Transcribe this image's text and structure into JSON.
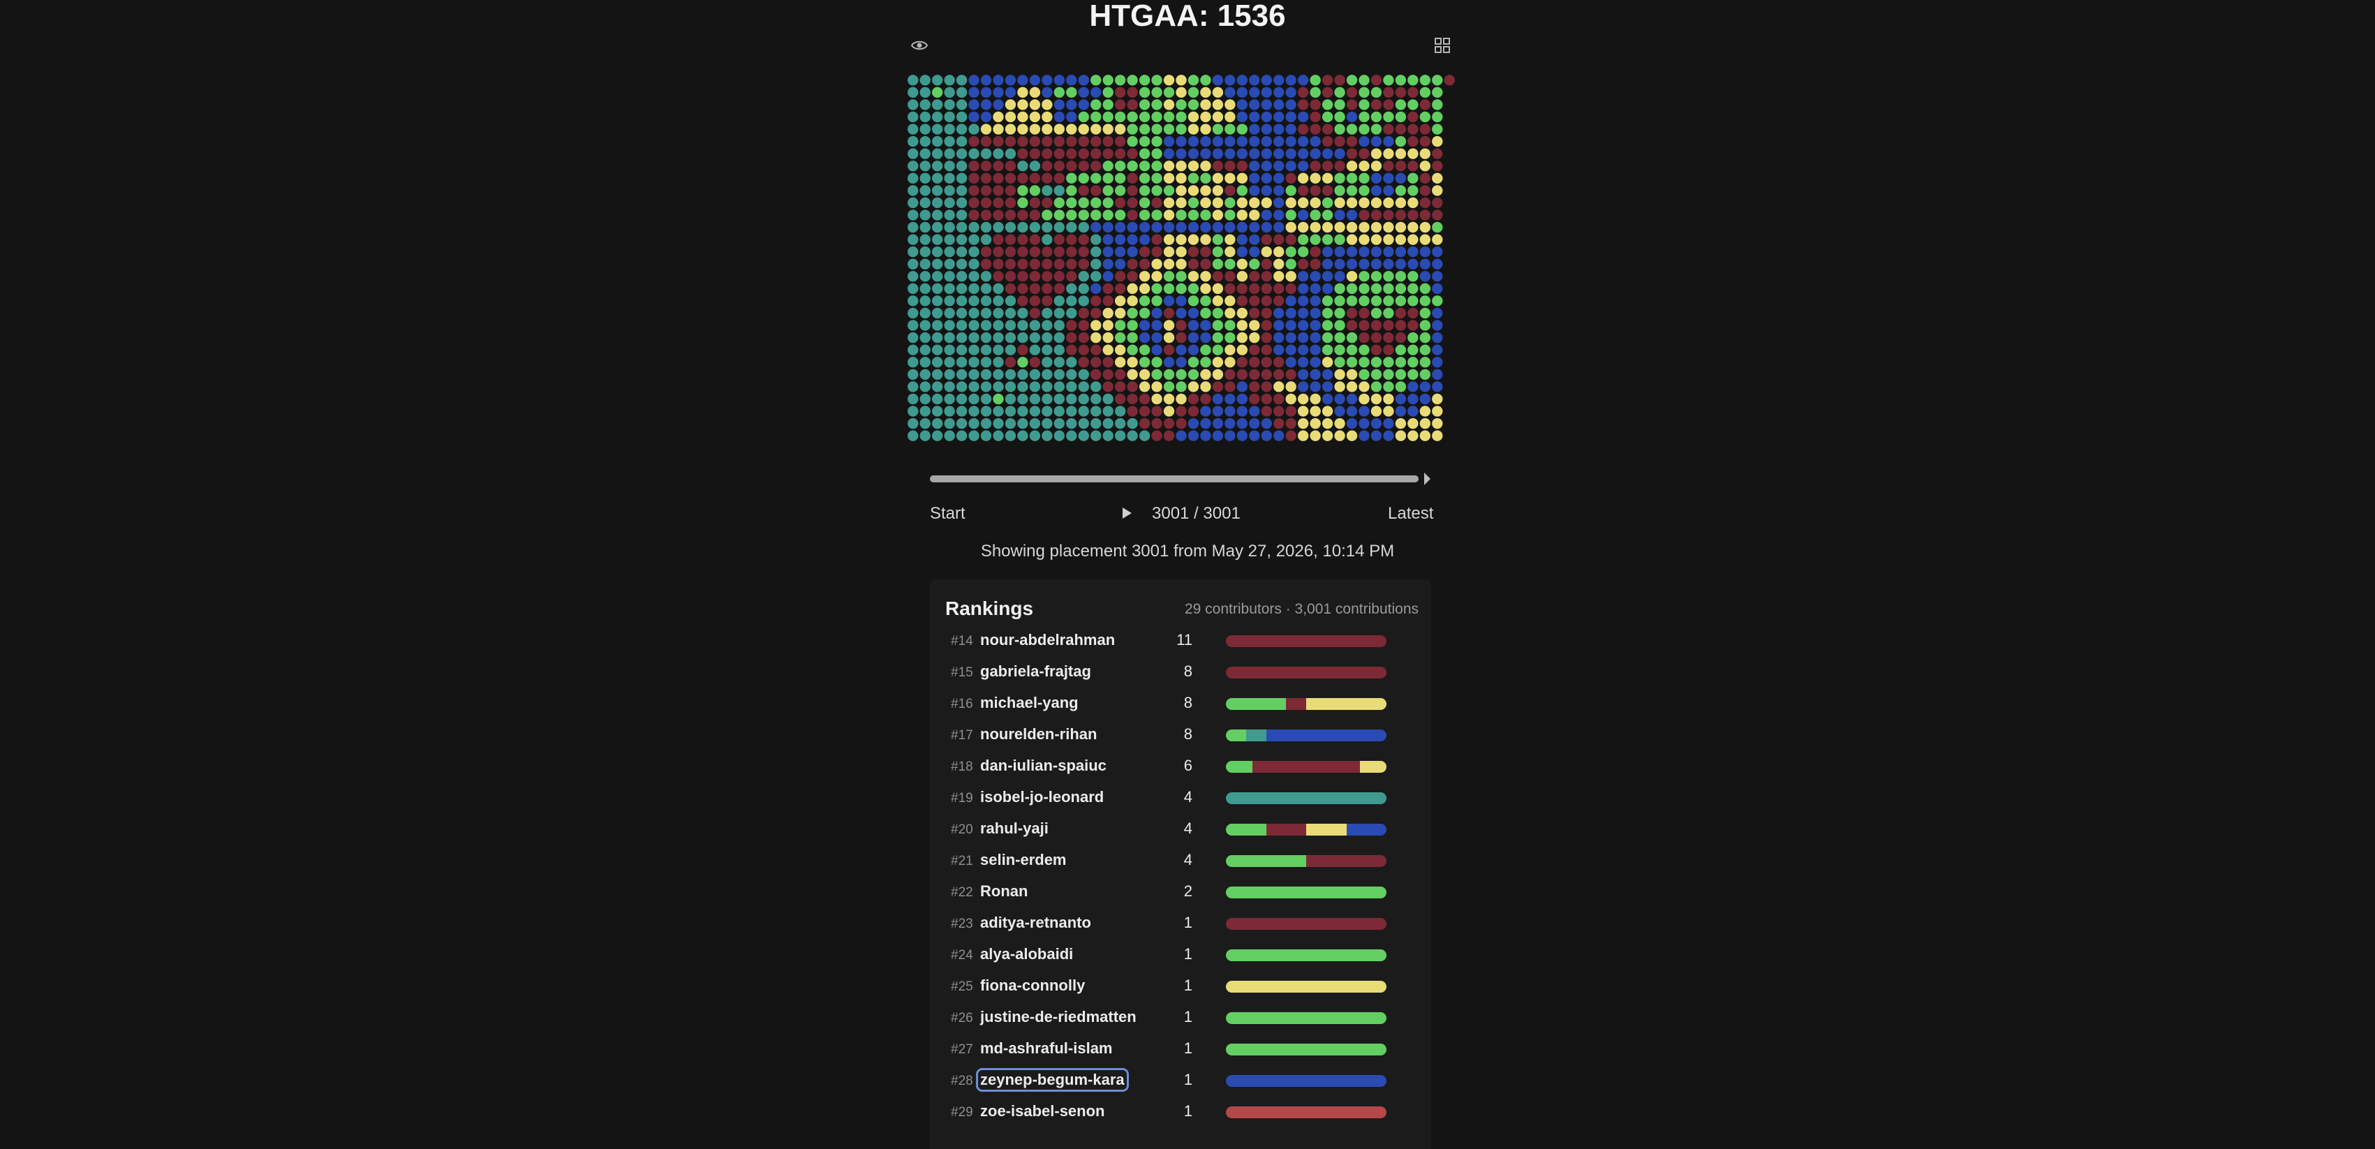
{
  "title": "HTGAA: 1536",
  "icons": {
    "view": "eye-icon",
    "layout": "grid-icon"
  },
  "colors": {
    "background": "#141414",
    "panel": "#1b1b1b",
    "green": "#63cf63",
    "teal": "#3f9b8f",
    "blue": "#2a4bb3",
    "maroon": "#7d2a36",
    "yellow": "#e9dc78",
    "salmon": "#b44848"
  },
  "canvas": {
    "cols": 45,
    "rows": 30,
    "cell_colors": [
      "TTTTTBBBBBBBBBBGGGGGG YYGGBBBBBBBBGMMGGMGGGGGM",
      "TTGTTBBBBYYBGGBBGMMGG GYGYYBBBBBBMGMGMGGMMMGG",
      "TTTTTBBBYYYYBBBGGMMGG YGGYYYBBBBBMMGGMGMMGGMG",
      "TTTTTBBYYYYYBBGGGGGGG GGYYYYBBBBBBMGGBGGGGMGG",
      "TTTTTTYYYYYYYYYYYYGGG GGYYGGGBBBBMMMGGGGMMMMG",
      "TTTTTMMMMMMMMMMMMMGGG BBBBBBBBBBBBBMMMBBBGMMY",
      "TTTTTTTTTMMMMMMMMMMGG BBBBBBBBBBBBBBBMMYYYYYM",
      "TTTTTMMMMTTMMMMMGGGGG YYYYMMMBBBBBMMMYYYMMMYM",
      "TTTTTMMMMMMMMGGGGGMGG YYGGYYYBBBMYYYGGGBBBGMY",
      "TTTTTMMMMGGTTGMMGGMGG GYYYYMGBBBGMMMGGGBBGGMY",
      "TTTTTMMMMGMMGGGGGMMGM YYGYYGYYYBYYYGYYYYYYYMM",
      "TTTTTMMMMMMGGGGGGGMGG YGGGYGYYBBGBGGBBMMMMMMM",
      "TTTTTTTTTTTTTTTBBBBBB BBBBBBBBBBYYYYYYYYYYYYG",
      "TTTTTTTMMMMTMMMTBBBBM YYYYGYBBMMMGGGGYYYYYYYY",
      "TTTTTTMMMMMMMMMTBBBMM YYMMGYBBYYGGMBBBBBBBBBB",
      "TTTTTTMMMMMMMMMTBBMMY YYMMGGYGMYGMMBBBBBBBBBB",
      "TTTTTTTMMMMMMMTTBMMYY GGYYMMYMMYYBBBBYGGGGGBB",
      "TTTTTTTTMMMMMTTBMMYYG GGGYYMMMMMMBBBGGGGGGGGB",
      "TTTTTTTTTMMMTTTMMYYGG BBGGYYMMMMBBBGGGGGGGGGG",
      "TTTTTTTTTTMTTTMMYYGGB MBBGGYYMMBBBBGGMMGGMMGB",
      "TTTTTTTTTTTTTMMYYGGBB YMBBGGYYMBBBBGGMMMMMMGB",
      "TTTTTTTTTTTTTMMYYGGBB YMBBGGYYMBBBBGGGMMMMGGB",
      "TTTTTTTTTMTTTMMMYYGGB MBBGGYYMMBBBBGGGGMMGGGB",
      "TTTTTTTTMGMTTTMMMYYGG BBGGYYMMMMBBBYGGGGGGGGB",
      "TTTTTTTTTTTTTTTMMMYYG GGGYYMMMMMMBBBYYGGGGGGB",
      "TTTTTTTTTTTTTTTTMMMYY GGYYMMBMMYYBBBYYYGGGBBB",
      "TTTTTTTGTTTTTTTTTMMMY YYMMBBBMMMYYYBBBYYYBBBY",
      "TTTTTTTTTTTTTTTTTTMMM YMMBBBBBMMMYYYBBBYYBBYY",
      "TTTTTTTTTTTTTTTTTTTMM MMBBBBBBBMMYYYYBBBBYYYY",
      "TTTTTTTTTTTTTTTTTTTTM MBBBBBBBBBMYYYYYBBBYYYY"
    ]
  },
  "timeline": {
    "start_label": "Start",
    "latest_label": "Latest",
    "counter": "3001 / 3001",
    "progress": 1.0,
    "placement_text": "Showing placement 3001 from May 27, 2026, 10:14 PM"
  },
  "rankings": {
    "title": "Rankings",
    "summary": "29 contributors · 3,001 contributions",
    "rows": [
      {
        "rank": "#14",
        "name": "nour-abdelrahman",
        "count": "11",
        "segments": [
          [
            "#7d2a36",
            1
          ]
        ]
      },
      {
        "rank": "#15",
        "name": "gabriela-frajtag",
        "count": "8",
        "segments": [
          [
            "#7d2a36",
            1
          ]
        ]
      },
      {
        "rank": "#16",
        "name": "michael-yang",
        "count": "8",
        "segments": [
          [
            "#63cf63",
            3
          ],
          [
            "#7d2a36",
            1
          ],
          [
            "#e9dc78",
            4
          ]
        ]
      },
      {
        "rank": "#17",
        "name": "nourelden-rihan",
        "count": "8",
        "segments": [
          [
            "#63cf63",
            1
          ],
          [
            "#3f9b8f",
            1
          ],
          [
            "#2a4bb3",
            6
          ]
        ]
      },
      {
        "rank": "#18",
        "name": "dan-iulian-spaiuc",
        "count": "6",
        "segments": [
          [
            "#63cf63",
            1
          ],
          [
            "#7d2a36",
            4
          ],
          [
            "#e9dc78",
            1
          ]
        ]
      },
      {
        "rank": "#19",
        "name": "isobel-jo-leonard",
        "count": "4",
        "segments": [
          [
            "#3f9b8f",
            4
          ]
        ]
      },
      {
        "rank": "#20",
        "name": "rahul-yaji",
        "count": "4",
        "segments": [
          [
            "#63cf63",
            1
          ],
          [
            "#7d2a36",
            1
          ],
          [
            "#e9dc78",
            1
          ],
          [
            "#2a4bb3",
            1
          ]
        ]
      },
      {
        "rank": "#21",
        "name": "selin-erdem",
        "count": "4",
        "segments": [
          [
            "#63cf63",
            2
          ],
          [
            "#7d2a36",
            2
          ]
        ]
      },
      {
        "rank": "#22",
        "name": "Ronan",
        "count": "2",
        "segments": [
          [
            "#63cf63",
            2
          ]
        ]
      },
      {
        "rank": "#23",
        "name": "aditya-retnanto",
        "count": "1",
        "segments": [
          [
            "#7d2a36",
            1
          ]
        ]
      },
      {
        "rank": "#24",
        "name": "alya-alobaidi",
        "count": "1",
        "segments": [
          [
            "#63cf63",
            1
          ]
        ]
      },
      {
        "rank": "#25",
        "name": "fiona-connolly",
        "count": "1",
        "segments": [
          [
            "#e9dc78",
            1
          ]
        ]
      },
      {
        "rank": "#26",
        "name": "justine-de-riedmatten",
        "count": "1",
        "segments": [
          [
            "#63cf63",
            1
          ]
        ]
      },
      {
        "rank": "#27",
        "name": "md-ashraful-islam",
        "count": "1",
        "segments": [
          [
            "#63cf63",
            1
          ]
        ]
      },
      {
        "rank": "#28",
        "name": "zeynep-begum-kara",
        "count": "1",
        "segments": [
          [
            "#2a4bb3",
            1
          ]
        ],
        "focused": true
      },
      {
        "rank": "#29",
        "name": "zoe-isabel-senon",
        "count": "1",
        "segments": [
          [
            "#b44848",
            1
          ]
        ]
      }
    ]
  }
}
